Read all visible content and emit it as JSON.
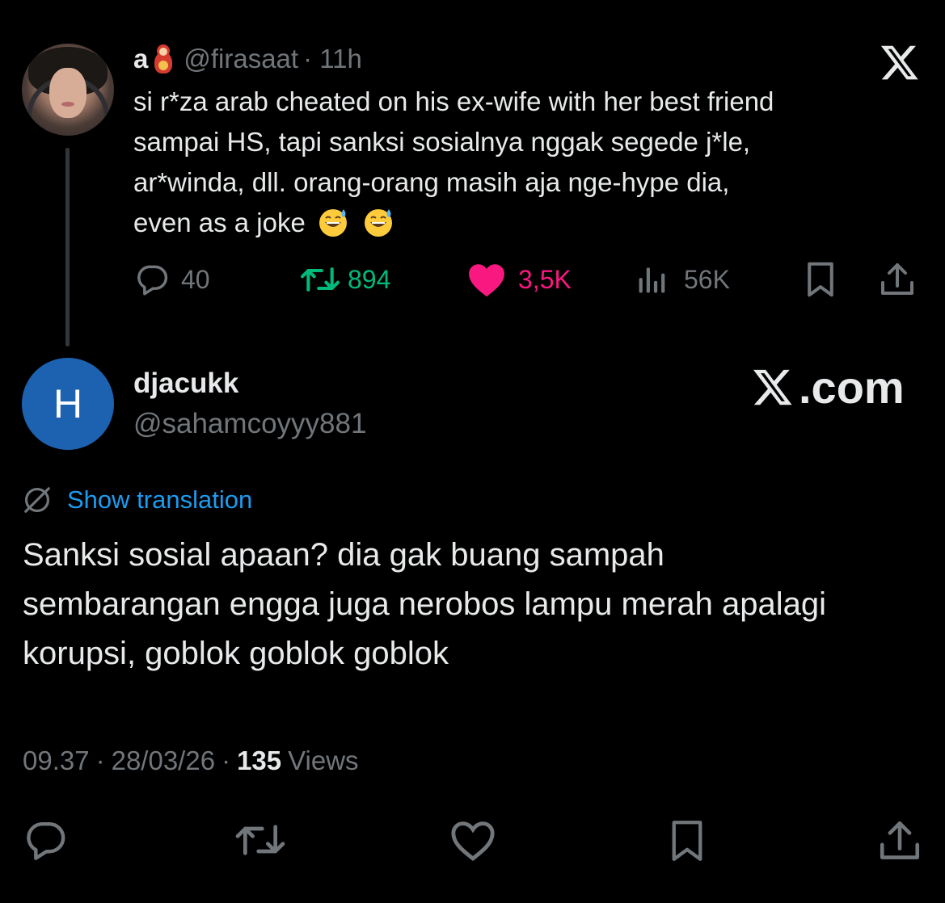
{
  "parent_tweet": {
    "display_name": "a",
    "name_emoji": "matryoshka-doll-emoji",
    "handle": "@firasaat",
    "time": "· 11h",
    "text": "si r*za arab cheated on his ex-wife with her best friend\nsampai HS, tapi sanksi sosialnya nggak segede j*le,\nar*winda, dll. orang-orang masih aja nge-hype dia,\neven as a joke",
    "trailing_emojis": [
      "grinning-face-with-sweat-emoji",
      "grinning-face-with-sweat-emoji"
    ],
    "stats": {
      "replies": "40",
      "retweets": "894",
      "likes": "3,5K",
      "views": "56K"
    }
  },
  "reply_tweet": {
    "avatar_letter": "H",
    "display_name": "djacukk",
    "handle": "@sahamcoyyy881",
    "watermark": ".com",
    "show_translation": "Show translation",
    "text": "Sanksi sosial apaan? dia gak buang sampah\nsembarangan engga juga nerobos lampu merah apalagi\nkorupsi, goblok goblok goblok",
    "time": "09.37",
    "date": "28/03/26",
    "views_count": "135",
    "views_label": "Views"
  },
  "colors": {
    "background": "#000000",
    "text": "#e7e9ea",
    "secondary": "#71767b",
    "accent_blue": "#1d9bf0",
    "retweet_green": "#00ba7c",
    "like_pink": "#f91880",
    "avatar_blue": "#1d62b0"
  }
}
